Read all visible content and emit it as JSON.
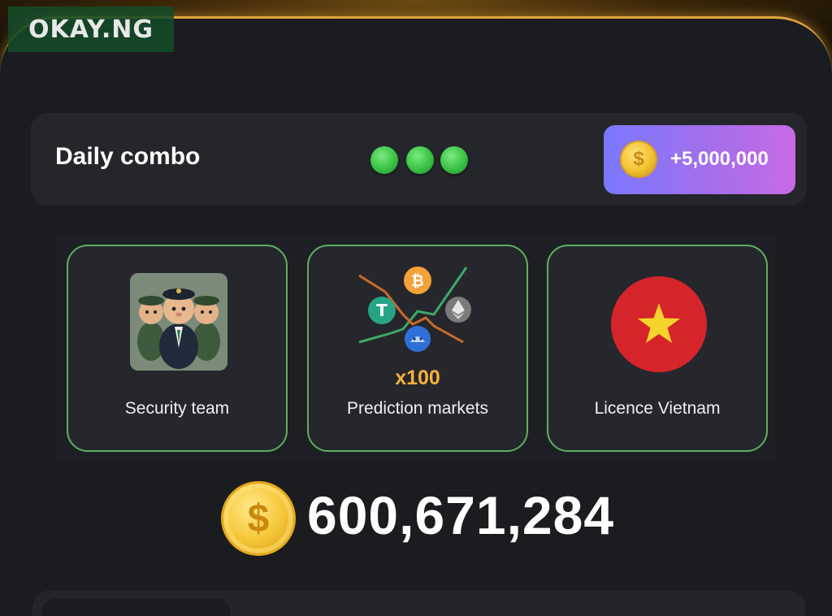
{
  "watermark": {
    "text": "OKAY.NG"
  },
  "combo": {
    "title": "Daily combo",
    "completed_dots": 3,
    "reward_label": "+5,000,000",
    "coin_symbol": "$"
  },
  "cards": [
    {
      "label": "Security team",
      "icon": "hamster-security-team-icon"
    },
    {
      "label": "Prediction markets",
      "icon": "prediction-markets-icon",
      "badge": "x100"
    },
    {
      "label": "Licence Vietnam",
      "icon": "vietnam-flag-icon"
    }
  ],
  "balance": {
    "coin_symbol": "$",
    "value": "600,671,284"
  },
  "colors": {
    "accent_gold": "#e0a53a",
    "dot_green": "#39c243",
    "badge_gradient_start": "#7a78ff",
    "badge_gradient_end": "#c86ae6",
    "card_border": "#5fae62"
  }
}
